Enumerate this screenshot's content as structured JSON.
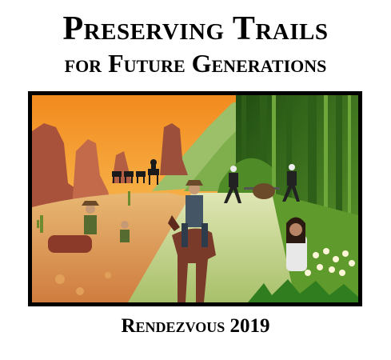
{
  "poster": {
    "title_line1": "Preserving Trails",
    "title_line2": "for Future Generations",
    "footer": "Rendezvous 2019"
  },
  "colors": {
    "frame": "#000000",
    "sky_orange": "#f7a12a",
    "sky_yellow": "#fbe18a",
    "desert_red": "#b5533a",
    "forest_green": "#3f7a22",
    "trail": "#c9d89a"
  }
}
